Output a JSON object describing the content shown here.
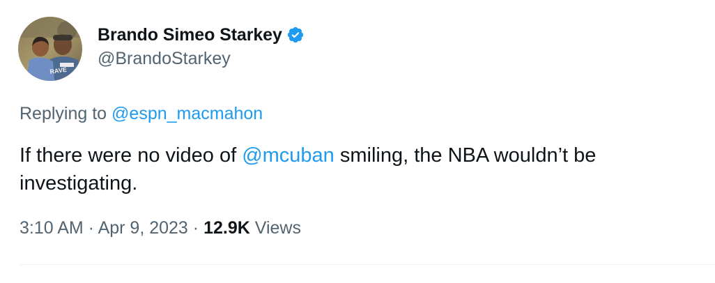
{
  "author": {
    "display_name": "Brando Simeo Starkey",
    "handle": "@BrandoStarkey",
    "verified": true,
    "avatar_icon": "profile-photo"
  },
  "reply": {
    "prefix": "Replying to ",
    "to_handle": "@espn_macmahon"
  },
  "tweet": {
    "text_before": "If there were no video of ",
    "mention": "@mcuban",
    "text_after": " smiling, the NBA wouldn’t be investigating."
  },
  "meta": {
    "time": "3:10 AM",
    "separator_1": " · ",
    "date": "Apr 9, 2023",
    "separator_2": " · ",
    "views_count": "12.9K",
    "views_label": " Views"
  },
  "colors": {
    "text_primary": "#0f1419",
    "text_secondary": "#536471",
    "link": "#1d9bf0",
    "divider": "#eff3f4",
    "verified_badge": "#1d9bf0"
  }
}
